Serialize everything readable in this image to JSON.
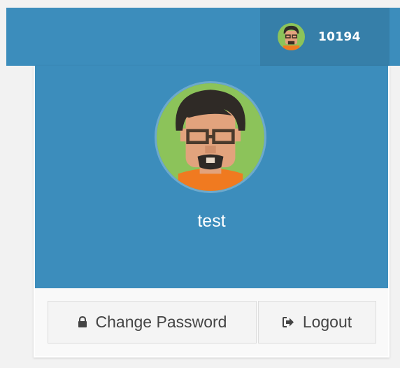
{
  "navbar": {
    "user_id_label": "10194",
    "avatar_icon": "user-avatar-icon"
  },
  "dropdown": {
    "header_name": "test",
    "avatar_icon": "user-avatar-icon",
    "buttons": {
      "change_password": {
        "label": "Change Password",
        "icon": "lock-icon"
      },
      "logout": {
        "label": "Logout",
        "icon": "sign-out-icon"
      }
    }
  },
  "colors": {
    "primary": "#3c8dbc",
    "primary_dark": "#367fa9",
    "footer_bg": "#f9f9f9",
    "button_bg": "#f4f4f4"
  }
}
